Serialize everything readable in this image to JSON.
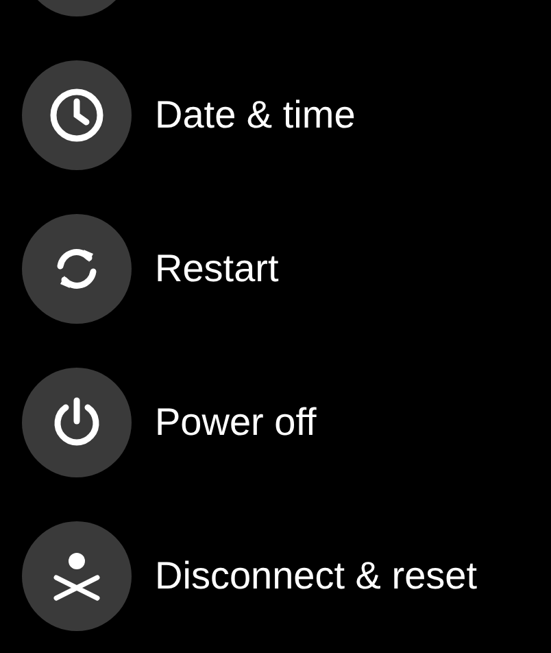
{
  "items": [
    {
      "kind": "clock",
      "label": "Date & time"
    },
    {
      "kind": "restart",
      "label": "Restart"
    },
    {
      "kind": "power",
      "label": "Power off"
    },
    {
      "kind": "disconnect",
      "label": "Disconnect & reset"
    }
  ]
}
